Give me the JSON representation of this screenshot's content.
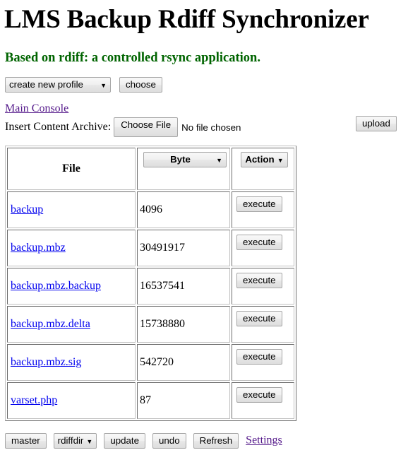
{
  "header": {
    "title": "LMS Backup Rdiff Synchronizer",
    "subtitle": "Based on rdiff: a controlled rsync application.",
    "title_color": "#000000",
    "subtitle_color": "#006400"
  },
  "profile_bar": {
    "profile_select_value": "create new profile",
    "choose_label": "choose"
  },
  "console": {
    "main_console_link": "Main Console",
    "link_color": "#551a8b"
  },
  "archive": {
    "label": "Insert Content Archive:",
    "choose_file_label": "Choose File",
    "file_status": "No file chosen",
    "upload_label": "upload"
  },
  "table": {
    "headers": {
      "file": "File",
      "byte_select_value": "Byte",
      "action_select_value": "Action"
    },
    "rows": [
      {
        "file": "backup",
        "size": "4096",
        "action_label": "execute"
      },
      {
        "file": "backup.mbz",
        "size": "30491917",
        "action_label": "execute"
      },
      {
        "file": "backup.mbz.backup",
        "size": "16537541",
        "action_label": "execute"
      },
      {
        "file": "backup.mbz.delta",
        "size": "15738880",
        "action_label": "execute"
      },
      {
        "file": "backup.mbz.sig",
        "size": "542720",
        "action_label": "execute"
      },
      {
        "file": "varset.php",
        "size": "87",
        "action_label": "execute"
      }
    ],
    "link_color": "#0000ee"
  },
  "footer": {
    "master_label": "master",
    "dir_select_value": "rdiffdir",
    "update_label": "update",
    "undo_label": "undo",
    "refresh_label": "Refresh",
    "settings_link": "Settings"
  }
}
